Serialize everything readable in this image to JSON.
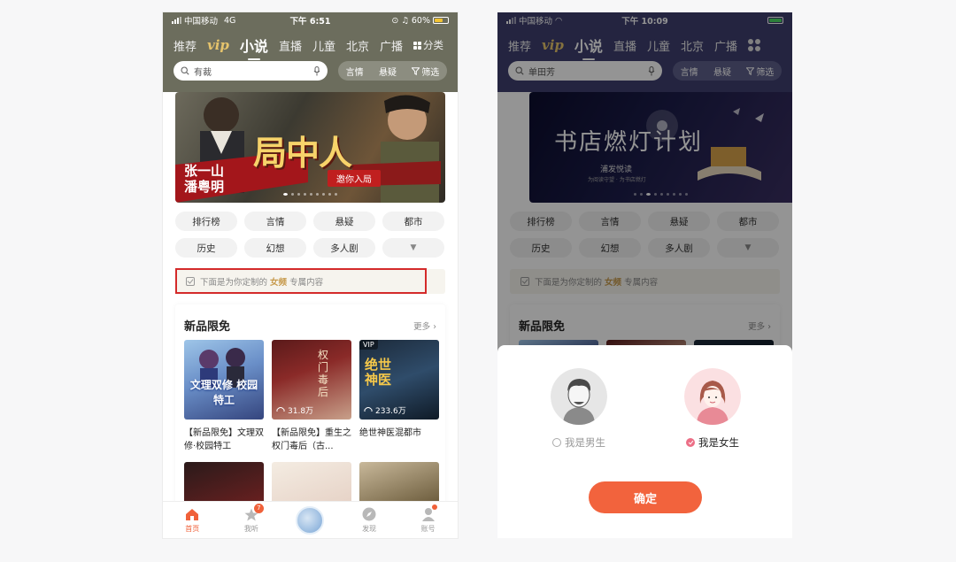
{
  "left": {
    "status": {
      "carrier": "中国移动",
      "network": "4G",
      "time": "下午 6:51",
      "battery": "60%"
    },
    "nav": {
      "tabs": [
        "推荐",
        "vip",
        "小说",
        "直播",
        "儿童",
        "北京",
        "广播"
      ],
      "active": "小说",
      "more": "分类"
    },
    "search": {
      "placeholder": "有裁",
      "filters": [
        "言情",
        "悬疑",
        "筛选"
      ]
    },
    "banner": {
      "title": "局中人",
      "actors": [
        "张一山",
        "潘粤明"
      ],
      "tagline": "邀你入局"
    },
    "categories": [
      "排行榜",
      "言情",
      "悬疑",
      "都市",
      "历史",
      "幻想",
      "多人剧"
    ],
    "notice": {
      "prefix": "下面是为你定制的",
      "highlight": "女频",
      "suffix": "专属内容"
    },
    "section": {
      "title": "新品限免",
      "more": "更多",
      "books": [
        {
          "name": "【新品限免】文理双修·校园特工",
          "cover_title": "文理双修 校园特工",
          "count": ""
        },
        {
          "name": "【新品限免】重生之权门毒后（古...",
          "cover_title": "权门毒后",
          "count": "31.8万"
        },
        {
          "name": "绝世神医混都市",
          "cover_title": "绝世神医",
          "count": "233.6万",
          "vip": "VIP"
        }
      ]
    },
    "tabbar": [
      {
        "label": "首页",
        "active": true
      },
      {
        "label": "我听",
        "badge": "7"
      },
      {
        "label": ""
      },
      {
        "label": "发现"
      },
      {
        "label": "账号",
        "dot": true
      }
    ]
  },
  "right": {
    "status": {
      "carrier": "中国移动",
      "time": "下午 10:09"
    },
    "nav": {
      "tabs": [
        "推荐",
        "vip",
        "小说",
        "直播",
        "儿童",
        "北京",
        "广播"
      ],
      "active": "小说"
    },
    "search": {
      "placeholder": "单田芳",
      "filters": [
        "言情",
        "悬疑",
        "筛选"
      ]
    },
    "banner": {
      "title": "书店燃灯计划",
      "subtitle": "浦发悦读",
      "line": "为阅读守望 · 为书店燃灯"
    },
    "categories": [
      "排行榜",
      "言情",
      "悬疑",
      "都市",
      "历史",
      "幻想",
      "多人剧"
    ],
    "notice": {
      "prefix": "下面是为你定制的",
      "highlight": "女频",
      "suffix": "专属内容"
    },
    "section": {
      "title": "新品限免",
      "more": "更多"
    },
    "gender": {
      "male": "我是男生",
      "female": "我是女生",
      "selected": "female"
    },
    "confirm": "确定"
  }
}
